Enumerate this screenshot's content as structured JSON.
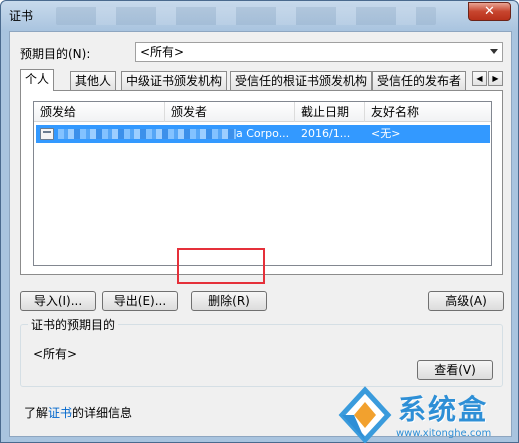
{
  "window": {
    "title": "证书",
    "close_label": "✕"
  },
  "purpose": {
    "label": "预期目的(N):",
    "selected": "<所有>"
  },
  "tabs": [
    {
      "label": "个人"
    },
    {
      "label": "其他人"
    },
    {
      "label": "中级证书颁发机构"
    },
    {
      "label": "受信任的根证书颁发机构"
    },
    {
      "label": "受信任的发布者"
    }
  ],
  "list": {
    "columns": [
      "颁发给",
      "颁发者",
      "截止日期",
      "友好名称"
    ],
    "rows": [
      {
        "issued_to": "",
        "issued_by": "a Corpo...",
        "expiry": "2016/1...",
        "friendly_name": "<无>"
      }
    ]
  },
  "buttons": {
    "import": "导入(I)...",
    "export": "导出(E)...",
    "delete": "删除(R)",
    "advanced": "高级(A)",
    "view": "查看(V)"
  },
  "group": {
    "title": "证书的预期目的",
    "value": "<所有>"
  },
  "footer": {
    "prefix": "了解",
    "link": "证书",
    "suffix": "的详细信息"
  },
  "watermark": {
    "text": "系统盒",
    "url": "www.xitonghe.com"
  }
}
